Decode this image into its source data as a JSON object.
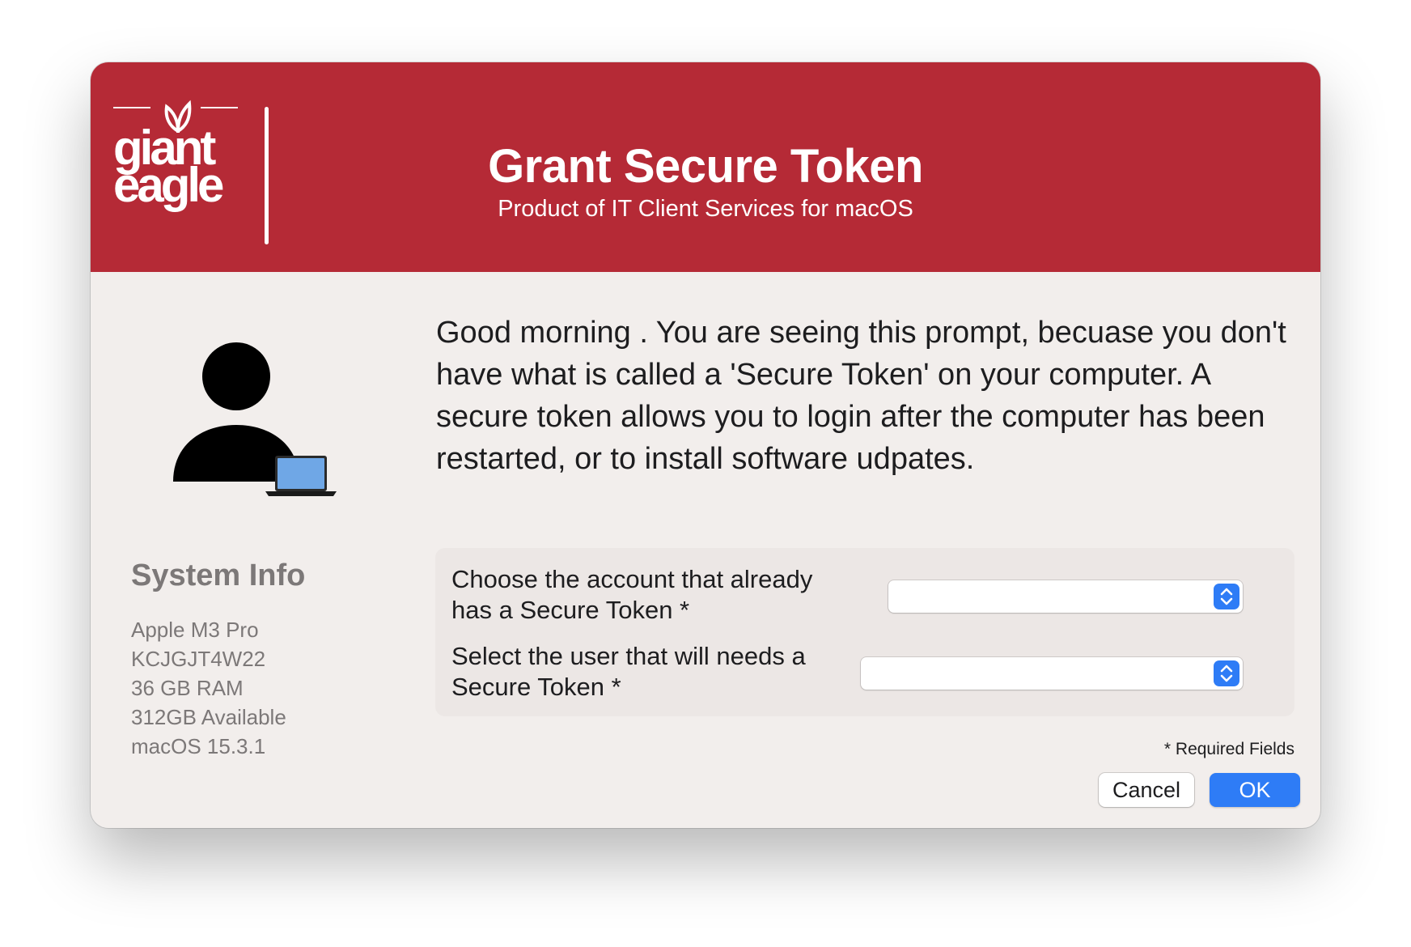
{
  "brand": {
    "logo_line1": "giant",
    "logo_line2": "eagle",
    "color": "#b52a36"
  },
  "header": {
    "title": "Grant Secure Token",
    "subtitle": "Product of IT Client Services for macOS"
  },
  "message": "Good morning . You are seeing this prompt, becuase you don't have what is called a 'Secure Token' on your computer. A secure token allows you to login after the computer has been restarted, or to install software udpates.",
  "system_info": {
    "title": "System Info",
    "items": [
      "Apple M3 Pro",
      "KCJGJT4W22",
      "36 GB RAM",
      "312GB Available",
      "macOS 15.3.1"
    ]
  },
  "form": {
    "account_label": "Choose the account that already has a Secure Token *",
    "account_value": "",
    "user_label": "Select the user that will needs a Secure Token *",
    "user_value": "",
    "required_note": "* Required Fields"
  },
  "buttons": {
    "cancel": "Cancel",
    "ok": "OK"
  },
  "colors": {
    "accent": "#2e7cf6",
    "banner": "#b52a36"
  },
  "icons": {
    "avatar": "person-with-laptop-icon",
    "select": "chevron-up-down-icon"
  }
}
